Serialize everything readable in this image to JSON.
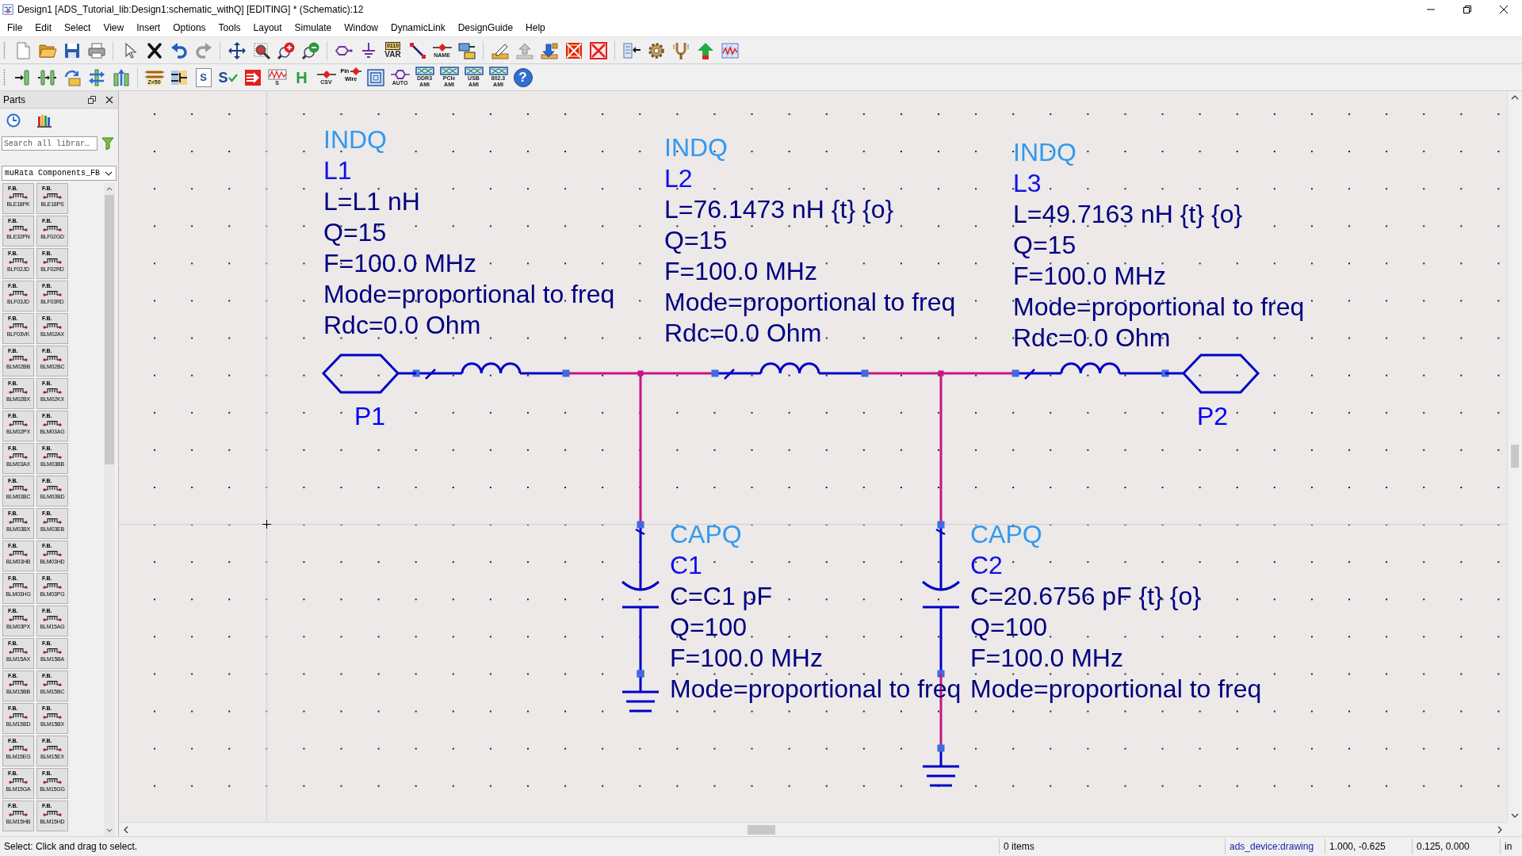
{
  "window": {
    "title": "Design1 [ADS_Tutorial_lib:Design1:schematic_withQ] [EDITING] * (Schematic):12"
  },
  "menu": [
    "File",
    "Edit",
    "Select",
    "View",
    "Insert",
    "Options",
    "Tools",
    "Layout",
    "Simulate",
    "Window",
    "DynamicLink",
    "DesignGuide",
    "Help"
  ],
  "toolbars": [
    {
      "groups": [
        [
          {
            "kind": "new"
          },
          {
            "kind": "open"
          },
          {
            "kind": "save"
          },
          {
            "kind": "print"
          }
        ],
        [
          {
            "kind": "pointer"
          },
          {
            "kind": "delete"
          },
          {
            "kind": "undo"
          },
          {
            "kind": "redo"
          }
        ],
        [
          {
            "kind": "move"
          },
          {
            "kind": "zoom-area"
          },
          {
            "kind": "zoom-in"
          },
          {
            "kind": "zoom-out"
          }
        ],
        [
          {
            "kind": "port"
          },
          {
            "kind": "ground"
          },
          {
            "kind": "var",
            "texts": [
              "0110",
              "VAR"
            ]
          },
          {
            "kind": "wire"
          },
          {
            "kind": "name",
            "texts": [
              "NAME"
            ]
          },
          {
            "kind": "insert"
          }
        ],
        [
          {
            "kind": "edit"
          },
          {
            "kind": "push"
          },
          {
            "kind": "pop"
          },
          {
            "kind": "deactivate"
          },
          {
            "kind": "short"
          }
        ],
        [
          {
            "kind": "back"
          },
          {
            "kind": "gear"
          },
          {
            "kind": "probe"
          },
          {
            "kind": "tune"
          },
          {
            "kind": "graph"
          }
        ]
      ]
    },
    {
      "groups": [
        [
          {
            "kind": "align-a"
          },
          {
            "kind": "align-b"
          },
          {
            "kind": "align-c"
          },
          {
            "kind": "align-d"
          },
          {
            "kind": "align-e"
          }
        ],
        [
          {
            "kind": "z50",
            "texts": [
              "Z=50"
            ]
          },
          {
            "kind": "lines"
          },
          {
            "kind": "s-box",
            "texts": [
              "S"
            ]
          },
          {
            "kind": "s-check",
            "texts": [
              "S"
            ]
          },
          {
            "kind": "red-arrows"
          },
          {
            "kind": "s-wave",
            "texts": [
              "S"
            ]
          },
          {
            "kind": "letter",
            "texts": [
              "H"
            ]
          },
          {
            "kind": "csv",
            "texts": [
              "CSV"
            ]
          },
          {
            "kind": "pin-wire",
            "texts": [
              "Pin",
              "Wire"
            ]
          },
          {
            "kind": "target"
          },
          {
            "kind": "auto",
            "texts": [
              "AUTO"
            ]
          },
          {
            "kind": "ami",
            "texts": [
              "DDR3",
              "AMI"
            ]
          },
          {
            "kind": "ami",
            "texts": [
              "PCIe AMI"
            ]
          },
          {
            "kind": "ami",
            "texts": [
              "USB AMI"
            ]
          },
          {
            "kind": "ami",
            "texts": [
              "802.3 AMI"
            ]
          },
          {
            "kind": "help",
            "texts": [
              "?"
            ]
          }
        ]
      ]
    }
  ],
  "parts_panel": {
    "title": "Parts",
    "search": {
      "placeholder": "Search all librar…"
    },
    "library": "muRata Components_FB",
    "items": [
      {
        "tag": "F.B.",
        "name": "BLE18PK"
      },
      {
        "tag": "F.B.",
        "name": "BLE18PS"
      },
      {
        "tag": "F.B.",
        "name": "BLE32PN"
      },
      {
        "tag": "F.B.",
        "name": "BLF02GD"
      },
      {
        "tag": "F.B.",
        "name": "BLF02JD"
      },
      {
        "tag": "F.B.",
        "name": "BLF02RD"
      },
      {
        "tag": "F.B.",
        "name": "BLF03JD"
      },
      {
        "tag": "F.B.",
        "name": "BLF03RD"
      },
      {
        "tag": "F.B.",
        "name": "BLF03VK"
      },
      {
        "tag": "F.B.",
        "name": "BLM02AX"
      },
      {
        "tag": "F.B.",
        "name": "BLM02BB"
      },
      {
        "tag": "F.B.",
        "name": "BLM02BC"
      },
      {
        "tag": "F.B.",
        "name": "BLM02BX"
      },
      {
        "tag": "F.B.",
        "name": "BLM02KX"
      },
      {
        "tag": "F.B.",
        "name": "BLM02PX"
      },
      {
        "tag": "F.B.",
        "name": "BLM03AG"
      },
      {
        "tag": "F.B.",
        "name": "BLM03AX"
      },
      {
        "tag": "F.B.",
        "name": "BLM03BB"
      },
      {
        "tag": "F.B.",
        "name": "BLM03BC"
      },
      {
        "tag": "F.B.",
        "name": "BLM03BD"
      },
      {
        "tag": "F.B.",
        "name": "BLM03BX"
      },
      {
        "tag": "F.B.",
        "name": "BLM03EB"
      },
      {
        "tag": "F.B.",
        "name": "BLM03HB"
      },
      {
        "tag": "F.B.",
        "name": "BLM03HD"
      },
      {
        "tag": "F.B.",
        "name": "BLM03HG"
      },
      {
        "tag": "F.B.",
        "name": "BLM03PG"
      },
      {
        "tag": "F.B.",
        "name": "BLM03PX"
      },
      {
        "tag": "F.B.",
        "name": "BLM15AG"
      },
      {
        "tag": "F.B.",
        "name": "BLM15AX"
      },
      {
        "tag": "F.B.",
        "name": "BLM15BA"
      },
      {
        "tag": "F.B.",
        "name": "BLM15BB"
      },
      {
        "tag": "F.B.",
        "name": "BLM15BC"
      },
      {
        "tag": "F.B.",
        "name": "BLM15BD"
      },
      {
        "tag": "F.B.",
        "name": "BLM15BX"
      },
      {
        "tag": "F.B.",
        "name": "BLM15EG"
      },
      {
        "tag": "F.B.",
        "name": "BLM15EX"
      },
      {
        "tag": "F.B.",
        "name": "BLM15GA"
      },
      {
        "tag": "F.B.",
        "name": "BLM15GG"
      },
      {
        "tag": "F.B.",
        "name": "BLM15HB"
      },
      {
        "tag": "F.B.",
        "name": "BLM15HD"
      }
    ]
  },
  "schematic": {
    "ports": [
      {
        "name": "P1"
      },
      {
        "name": "P2"
      }
    ],
    "components": [
      {
        "kind": "inductor",
        "type": "INDQ",
        "instance": "L1",
        "params": [
          "L=L1 nH",
          "Q=15",
          "F=100.0 MHz",
          "Mode=proportional to freq",
          "Rdc=0.0 Ohm"
        ]
      },
      {
        "kind": "inductor",
        "type": "INDQ",
        "instance": "L2",
        "params": [
          "L=76.1473 nH {t} {o}",
          "Q=15",
          "F=100.0 MHz",
          "Mode=proportional to freq",
          "Rdc=0.0 Ohm"
        ]
      },
      {
        "kind": "inductor",
        "type": "INDQ",
        "instance": "L3",
        "params": [
          "L=49.7163 nH {t} {o}",
          "Q=15",
          "F=100.0 MHz",
          "Mode=proportional to freq",
          "Rdc=0.0 Ohm"
        ]
      },
      {
        "kind": "capacitor",
        "type": "CAPQ",
        "instance": "C1",
        "params": [
          "C=C1 pF",
          "Q=100",
          "F=100.0 MHz",
          "Mode=proportional to freq"
        ]
      },
      {
        "kind": "capacitor",
        "type": "CAPQ",
        "instance": "C2",
        "params": [
          "C=20.6756 pF {t} {o}",
          "Q=100",
          "F=100.0 MHz",
          "Mode=proportional to freq"
        ]
      }
    ]
  },
  "status_bar": {
    "message": "Select: Click and drag to select.",
    "fields": [
      {
        "kind": "text",
        "text": "0 items"
      },
      {
        "kind": "link",
        "text": "ads_device:drawing"
      },
      {
        "kind": "text",
        "text": "1.000, -0.625"
      },
      {
        "kind": "text",
        "text": "0.125, 0.000"
      },
      {
        "kind": "text",
        "text": "in"
      }
    ]
  }
}
